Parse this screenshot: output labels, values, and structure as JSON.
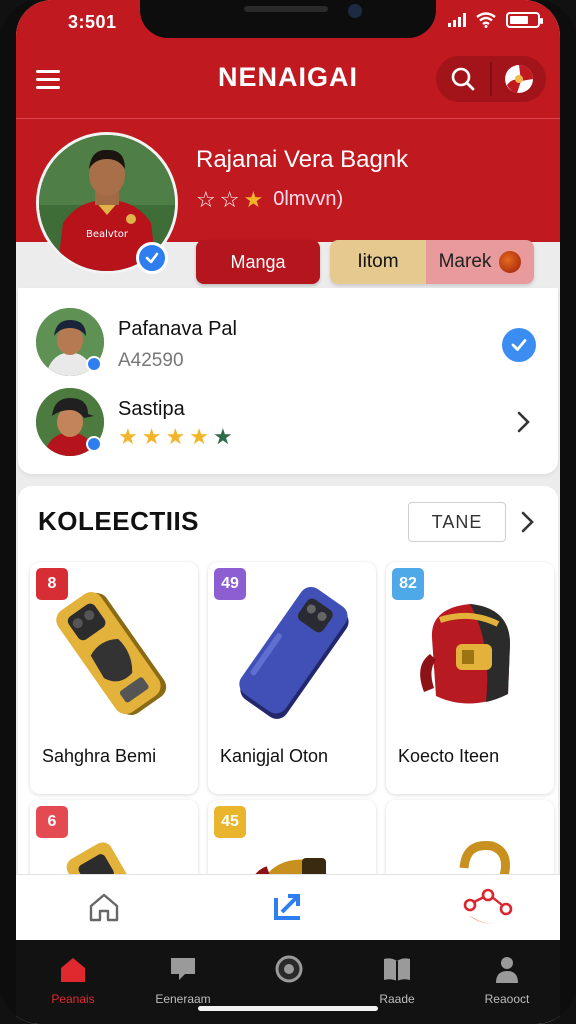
{
  "status_bar": {
    "time": "3:501"
  },
  "header": {
    "title": "NENAIGAI"
  },
  "profile": {
    "name": "Rajanai Vera Bagnk",
    "rating_text": "0lmvvn)",
    "buttons": {
      "primary": "Manga",
      "secondary_left": "Iitom",
      "secondary_right": "Marek"
    }
  },
  "jersey_text": "Bealvtor",
  "friends": [
    {
      "name": "Pafanava Pal",
      "sub": "A42590"
    },
    {
      "name": "Sastipa",
      "stars": 5
    }
  ],
  "collections": {
    "title": "KOLEECTIIS",
    "take_button": "TANE",
    "items": [
      {
        "badge": "8",
        "badge_color": "#d72d35",
        "caption": "Sahghra Bemi"
      },
      {
        "badge": "49",
        "badge_color": "#8b5fd1",
        "caption": "Kanigjal Oton"
      },
      {
        "badge": "82",
        "badge_color": "#4fa9e8",
        "caption": "Koecto Iteen"
      },
      {
        "badge": "6",
        "badge_color": "#e34a52",
        "caption": ""
      },
      {
        "badge": "45",
        "badge_color": "#e8b52c",
        "caption": ""
      },
      {
        "badge": "",
        "badge_color": "#ffffff",
        "caption": ""
      }
    ]
  },
  "tabs": [
    {
      "label": "Peanais",
      "icon": "home-icon"
    },
    {
      "label": "Eeneraam",
      "icon": "message-icon"
    },
    {
      "label": "",
      "icon": "circle-icon"
    },
    {
      "label": "Raade",
      "icon": "book-icon"
    },
    {
      "label": "Reaooct",
      "icon": "person-icon"
    }
  ],
  "colors": {
    "brand_red": "#c11920",
    "accent_blue": "#2f7ef0"
  }
}
